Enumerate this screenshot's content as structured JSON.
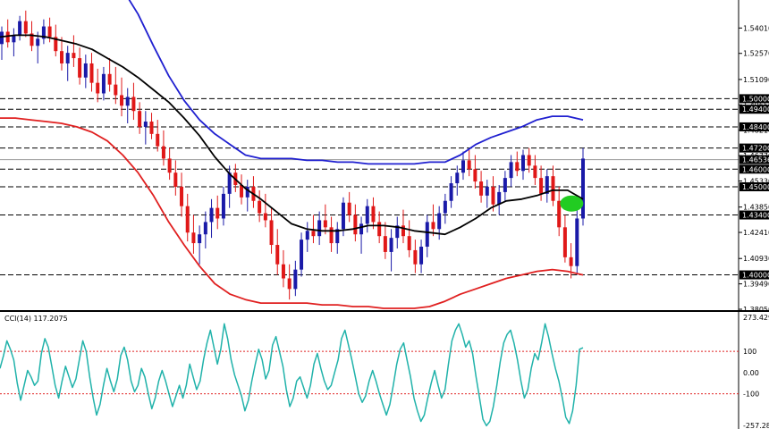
{
  "chart_data": [
    {
      "type": "candlestick",
      "title": "",
      "ylim": [
        1.3805,
        1.556
      ],
      "price_ticks": [
        "1.54010",
        "1.52570",
        "1.51090",
        "1.49650",
        "1.48210",
        "1.46770",
        "1.45330",
        "1.43850",
        "1.42410",
        "1.40930",
        "1.39490",
        "1.38050"
      ],
      "horizontal_levels": [
        {
          "value": 1.5,
          "label": "1.50000"
        },
        {
          "value": 1.494,
          "label": "1.49400"
        },
        {
          "value": 1.484,
          "label": "1.48400"
        },
        {
          "value": 1.472,
          "label": "1.47200"
        },
        {
          "value": 1.46,
          "label": "1.46000"
        },
        {
          "value": 1.45,
          "label": "1.45000"
        },
        {
          "value": 1.434,
          "label": "1.43400"
        },
        {
          "value": 1.4,
          "label": "1.40000"
        }
      ],
      "current_price": {
        "value": 1.4654,
        "label": "1.46536"
      },
      "series": [
        {
          "name": "",
          "kind": "moving-average",
          "color": "#000000",
          "values": [
            1.535,
            1.536,
            1.536,
            1.535,
            1.533,
            1.531,
            1.528,
            1.523,
            1.518,
            1.512,
            1.505,
            1.498,
            1.489,
            1.479,
            1.467,
            1.457,
            1.449,
            1.443,
            1.436,
            1.429,
            1.426,
            1.425,
            1.425,
            1.426,
            1.428,
            1.428,
            1.427,
            1.425,
            1.424,
            1.423,
            1.427,
            1.432,
            1.438,
            1.442,
            1.443,
            1.445,
            1.448,
            1.448,
            1.443
          ]
        },
        {
          "name": "",
          "kind": "bollinger-upper",
          "color": "#2020d0",
          "values": [
            1.615,
            1.612,
            1.605,
            1.598,
            1.592,
            1.585,
            1.579,
            1.571,
            1.562,
            1.548,
            1.53,
            1.513,
            1.499,
            1.488,
            1.48,
            1.474,
            1.468,
            1.466,
            1.466,
            1.466,
            1.465,
            1.465,
            1.464,
            1.464,
            1.463,
            1.463,
            1.463,
            1.463,
            1.464,
            1.464,
            1.468,
            1.474,
            1.478,
            1.481,
            1.484,
            1.488,
            1.49,
            1.49,
            1.488
          ]
        },
        {
          "name": "",
          "kind": "bollinger-lower",
          "color": "#e02020",
          "values": [
            1.489,
            1.489,
            1.488,
            1.487,
            1.486,
            1.484,
            1.481,
            1.476,
            1.468,
            1.458,
            1.445,
            1.43,
            1.417,
            1.405,
            1.395,
            1.389,
            1.386,
            1.384,
            1.384,
            1.384,
            1.384,
            1.383,
            1.383,
            1.382,
            1.382,
            1.381,
            1.381,
            1.381,
            1.382,
            1.385,
            1.389,
            1.392,
            1.395,
            1.398,
            1.4,
            1.402,
            1.403,
            1.402,
            1.4
          ]
        }
      ],
      "candles": [
        [
          1.531,
          1.541,
          1.522,
          1.538
        ],
        [
          1.538,
          1.545,
          1.529,
          1.532
        ],
        [
          1.532,
          1.54,
          1.524,
          1.536
        ],
        [
          1.536,
          1.547,
          1.533,
          1.544
        ],
        [
          1.544,
          1.55,
          1.535,
          1.537
        ],
        [
          1.537,
          1.544,
          1.527,
          1.53
        ],
        [
          1.53,
          1.538,
          1.52,
          1.534
        ],
        [
          1.534,
          1.545,
          1.531,
          1.541
        ],
        [
          1.541,
          1.546,
          1.532,
          1.535
        ],
        [
          1.535,
          1.542,
          1.524,
          1.527
        ],
        [
          1.527,
          1.535,
          1.516,
          1.52
        ],
        [
          1.52,
          1.53,
          1.51,
          1.526
        ],
        [
          1.526,
          1.536,
          1.518,
          1.523
        ],
        [
          1.523,
          1.529,
          1.508,
          1.512
        ],
        [
          1.512,
          1.525,
          1.506,
          1.52
        ],
        [
          1.52,
          1.526,
          1.504,
          1.509
        ],
        [
          1.509,
          1.517,
          1.498,
          1.503
        ],
        [
          1.503,
          1.518,
          1.499,
          1.514
        ],
        [
          1.514,
          1.523,
          1.504,
          1.508
        ],
        [
          1.508,
          1.518,
          1.497,
          1.502
        ],
        [
          1.502,
          1.512,
          1.49,
          1.496
        ],
        [
          1.496,
          1.506,
          1.486,
          1.501
        ],
        [
          1.501,
          1.509,
          1.488,
          1.493
        ],
        [
          1.493,
          1.498,
          1.48,
          1.484
        ],
        [
          1.484,
          1.493,
          1.474,
          1.487
        ],
        [
          1.487,
          1.492,
          1.477,
          1.48
        ],
        [
          1.48,
          1.488,
          1.47,
          1.473
        ],
        [
          1.473,
          1.482,
          1.462,
          1.466
        ],
        [
          1.466,
          1.472,
          1.454,
          1.458
        ],
        [
          1.458,
          1.465,
          1.445,
          1.45
        ],
        [
          1.45,
          1.458,
          1.433,
          1.439
        ],
        [
          1.439,
          1.446,
          1.419,
          1.424
        ],
        [
          1.424,
          1.434,
          1.412,
          1.418
        ],
        [
          1.418,
          1.428,
          1.406,
          1.423
        ],
        [
          1.423,
          1.436,
          1.415,
          1.43
        ],
        [
          1.43,
          1.443,
          1.421,
          1.438
        ],
        [
          1.438,
          1.445,
          1.426,
          1.432
        ],
        [
          1.432,
          1.45,
          1.428,
          1.446
        ],
        [
          1.446,
          1.462,
          1.438,
          1.458
        ],
        [
          1.458,
          1.463,
          1.447,
          1.451
        ],
        [
          1.451,
          1.457,
          1.44,
          1.444
        ],
        [
          1.444,
          1.454,
          1.436,
          1.45
        ],
        [
          1.45,
          1.456,
          1.438,
          1.442
        ],
        [
          1.442,
          1.448,
          1.43,
          1.435
        ],
        [
          1.435,
          1.446,
          1.427,
          1.431
        ],
        [
          1.431,
          1.438,
          1.412,
          1.417
        ],
        [
          1.417,
          1.426,
          1.4,
          1.406
        ],
        [
          1.406,
          1.414,
          1.393,
          1.398
        ],
        [
          1.398,
          1.406,
          1.386,
          1.392
        ],
        [
          1.392,
          1.408,
          1.388,
          1.403
        ],
        [
          1.403,
          1.424,
          1.399,
          1.42
        ],
        [
          1.42,
          1.43,
          1.413,
          1.425
        ],
        [
          1.425,
          1.434,
          1.418,
          1.422
        ],
        [
          1.422,
          1.436,
          1.417,
          1.431
        ],
        [
          1.431,
          1.44,
          1.423,
          1.427
        ],
        [
          1.427,
          1.433,
          1.413,
          1.418
        ],
        [
          1.418,
          1.43,
          1.412,
          1.426
        ],
        [
          1.426,
          1.444,
          1.422,
          1.441
        ],
        [
          1.441,
          1.447,
          1.43,
          1.434
        ],
        [
          1.434,
          1.44,
          1.419,
          1.423
        ],
        [
          1.423,
          1.433,
          1.412,
          1.429
        ],
        [
          1.429,
          1.443,
          1.424,
          1.439
        ],
        [
          1.439,
          1.444,
          1.426,
          1.43
        ],
        [
          1.43,
          1.436,
          1.418,
          1.422
        ],
        [
          1.422,
          1.43,
          1.409,
          1.413
        ],
        [
          1.413,
          1.426,
          1.402,
          1.421
        ],
        [
          1.421,
          1.433,
          1.415,
          1.428
        ],
        [
          1.428,
          1.437,
          1.418,
          1.422
        ],
        [
          1.422,
          1.431,
          1.41,
          1.414
        ],
        [
          1.414,
          1.42,
          1.401,
          1.406
        ],
        [
          1.406,
          1.42,
          1.401,
          1.416
        ],
        [
          1.416,
          1.434,
          1.41,
          1.43
        ],
        [
          1.43,
          1.44,
          1.422,
          1.426
        ],
        [
          1.426,
          1.439,
          1.42,
          1.435
        ],
        [
          1.435,
          1.446,
          1.429,
          1.442
        ],
        [
          1.442,
          1.456,
          1.438,
          1.452
        ],
        [
          1.452,
          1.462,
          1.445,
          1.458
        ],
        [
          1.458,
          1.47,
          1.454,
          1.465
        ],
        [
          1.465,
          1.471,
          1.456,
          1.46
        ],
        [
          1.46,
          1.468,
          1.449,
          1.453
        ],
        [
          1.453,
          1.459,
          1.441,
          1.445
        ],
        [
          1.445,
          1.454,
          1.438,
          1.45
        ],
        [
          1.45,
          1.456,
          1.436,
          1.44
        ],
        [
          1.44,
          1.451,
          1.434,
          1.447
        ],
        [
          1.447,
          1.459,
          1.442,
          1.455
        ],
        [
          1.455,
          1.468,
          1.45,
          1.464
        ],
        [
          1.464,
          1.47,
          1.456,
          1.459
        ],
        [
          1.459,
          1.471,
          1.454,
          1.468
        ],
        [
          1.468,
          1.472,
          1.458,
          1.462
        ],
        [
          1.462,
          1.468,
          1.451,
          1.455
        ],
        [
          1.455,
          1.462,
          1.442,
          1.446
        ],
        [
          1.446,
          1.46,
          1.441,
          1.456
        ],
        [
          1.456,
          1.462,
          1.439,
          1.442
        ],
        [
          1.442,
          1.45,
          1.422,
          1.427
        ],
        [
          1.427,
          1.434,
          1.407,
          1.41
        ],
        [
          1.41,
          1.418,
          1.398,
          1.405
        ],
        [
          1.405,
          1.438,
          1.4,
          1.432
        ],
        [
          1.432,
          1.472,
          1.428,
          1.466
        ]
      ],
      "marker": {
        "shape": "ellipse",
        "color": "#22cc22",
        "at_candle_index": 96,
        "price": 1.4405
      }
    },
    {
      "type": "line",
      "title": "CCI(14) 117.2075",
      "ylim": [
        -257.2831,
        273.4299
      ],
      "ticks": [
        {
          "value": 273.4299,
          "label": "273.4299"
        },
        {
          "value": 100,
          "label": "100"
        },
        {
          "value": 0,
          "label": "0.00"
        },
        {
          "value": -100,
          "label": "-100"
        },
        {
          "value": -257.2831,
          "label": "-257.2831"
        }
      ],
      "levels": [
        100,
        -100
      ],
      "series": [
        {
          "name": "CCI(14)",
          "color": "#20b2aa",
          "values": [
            20,
            80,
            150,
            110,
            60,
            -50,
            -130,
            -60,
            10,
            -20,
            -60,
            -40,
            90,
            160,
            120,
            30,
            -60,
            -120,
            -40,
            30,
            -20,
            -70,
            -30,
            60,
            150,
            100,
            -20,
            -120,
            -200,
            -150,
            -60,
            20,
            -40,
            -90,
            -30,
            80,
            120,
            60,
            -40,
            -90,
            -60,
            20,
            -20,
            -100,
            -170,
            -120,
            -40,
            10,
            -40,
            -100,
            -160,
            -110,
            -60,
            -120,
            -60,
            40,
            -20,
            -80,
            -40,
            60,
            140,
            200,
            120,
            40,
            110,
            230,
            160,
            60,
            -10,
            -60,
            -110,
            -180,
            -130,
            -40,
            40,
            110,
            60,
            -30,
            10,
            130,
            170,
            100,
            30,
            -80,
            -160,
            -120,
            -40,
            -20,
            -70,
            -120,
            -60,
            40,
            90,
            20,
            -40,
            -80,
            -60,
            0,
            60,
            160,
            200,
            130,
            60,
            -20,
            -100,
            -140,
            -110,
            -40,
            10,
            -40,
            -100,
            -150,
            -200,
            -150,
            -60,
            40,
            110,
            140,
            60,
            -20,
            -120,
            -180,
            -230,
            -200,
            -120,
            -50,
            10,
            -60,
            -120,
            -80,
            40,
            150,
            200,
            230,
            180,
            120,
            150,
            90,
            -20,
            -120,
            -220,
            -250,
            -230,
            -160,
            -60,
            50,
            140,
            180,
            200,
            140,
            60,
            -40,
            -120,
            -80,
            20,
            90,
            60,
            140,
            230,
            170,
            90,
            20,
            -40,
            -120,
            -210,
            -240,
            -180,
            -60,
            110,
            117
          ]
        }
      ]
    }
  ]
}
